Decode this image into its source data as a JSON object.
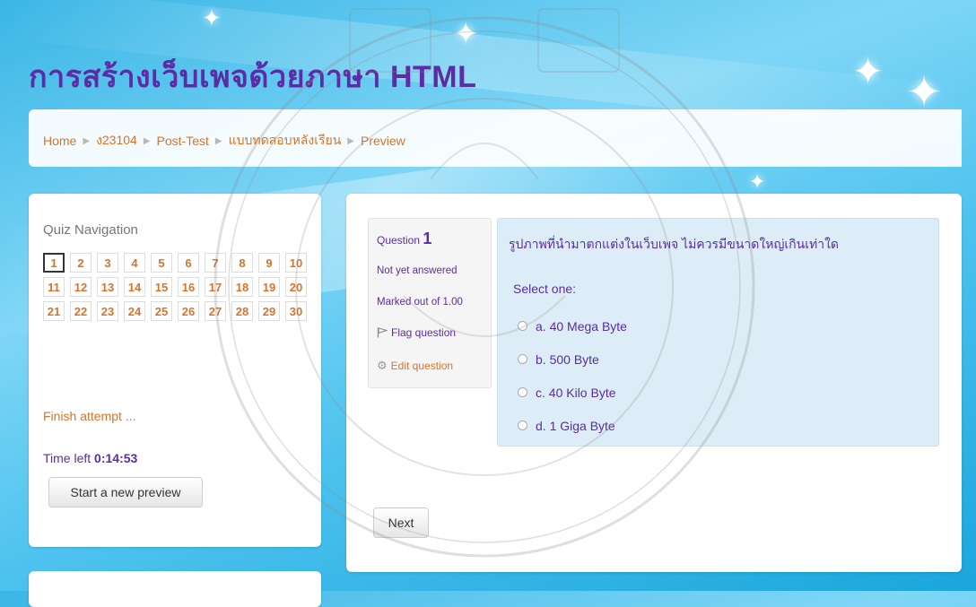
{
  "site": {
    "title": "การสร้างเว็บเพจด้วยภาษา HTML"
  },
  "breadcrumb": {
    "items": [
      "Home",
      "ง23104",
      "Post-Test",
      "แบบทดสอบหลังเรียน",
      "Preview"
    ]
  },
  "quiz_nav": {
    "title": "Quiz Navigation",
    "questions": [
      "1",
      "2",
      "3",
      "4",
      "5",
      "6",
      "7",
      "8",
      "9",
      "10",
      "11",
      "12",
      "13",
      "14",
      "15",
      "16",
      "17",
      "18",
      "19",
      "20",
      "21",
      "22",
      "23",
      "24",
      "25",
      "26",
      "27",
      "28",
      "29",
      "30"
    ],
    "current": "1",
    "finish_label": "Finish attempt ...",
    "time_label": "Time left",
    "time_value": "0:14:53",
    "new_preview_label": "Start a new preview"
  },
  "question": {
    "label": "Question",
    "number": "1",
    "state": "Not yet answered",
    "grade": "Marked out of 1.00",
    "flag_label": "Flag question",
    "edit_label": "Edit question",
    "text": "รูปภาพที่นำมาตกแต่งในเว็บเพจ ไม่ควรมีขนาดใหญ่เกินเท่าใด",
    "prompt": "Select one:",
    "answers": [
      {
        "label": "a. 40 Mega Byte"
      },
      {
        "label": "b. 500 Byte"
      },
      {
        "label": "c. 40 Kilo Byte"
      },
      {
        "label": "d. 1 Giga Byte"
      }
    ]
  },
  "footer": {
    "next_label": "Next"
  },
  "colors": {
    "title": "#5b2ca4",
    "link_orange": "#d9732b",
    "question_bg": "#dcedf7",
    "info_bg": "#f5f5f5"
  }
}
